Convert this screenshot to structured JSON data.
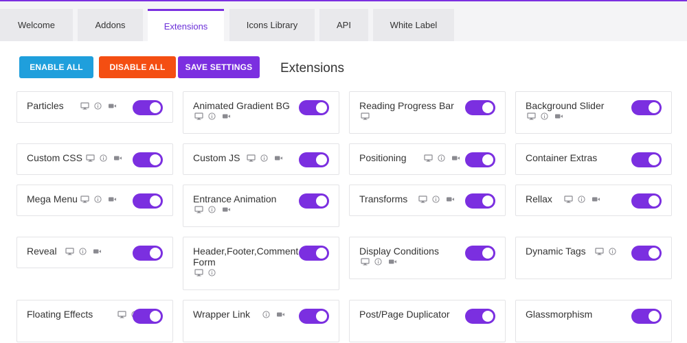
{
  "tabs": [
    "Welcome",
    "Addons",
    "Extensions",
    "Icons Library",
    "API",
    "White Label"
  ],
  "active_tab": "Extensions",
  "buttons": {
    "enable_all": "ENABLE ALL",
    "disable_all": "DISABLE ALL",
    "save_settings": "SAVE SETTINGS"
  },
  "section_title": "Extensions",
  "colors": {
    "accent": "#7b2fe0",
    "enable": "#1f9fdc",
    "disable": "#f44e12"
  },
  "extensions": [
    {
      "name": "Particles",
      "icons": [
        "desktop-icon",
        "info-icon",
        "video-icon"
      ],
      "enabled": true
    },
    {
      "name": "Animated Gradient BG",
      "icons": [
        "desktop-icon",
        "info-icon",
        "video-icon"
      ],
      "enabled": true
    },
    {
      "name": "Reading Progress Bar",
      "icons": [
        "desktop-icon"
      ],
      "enabled": true
    },
    {
      "name": "Background Slider",
      "icons": [
        "desktop-icon",
        "info-icon",
        "video-icon"
      ],
      "enabled": true
    },
    {
      "name": "Custom CSS",
      "icons": [
        "desktop-icon",
        "info-icon",
        "video-icon"
      ],
      "enabled": true
    },
    {
      "name": "Custom JS",
      "icons": [
        "desktop-icon",
        "info-icon",
        "video-icon"
      ],
      "enabled": true
    },
    {
      "name": "Positioning",
      "icons": [
        "desktop-icon",
        "info-icon",
        "video-icon"
      ],
      "enabled": true
    },
    {
      "name": "Container Extras",
      "icons": [],
      "enabled": true
    },
    {
      "name": "Mega Menu",
      "icons": [
        "desktop-icon",
        "info-icon",
        "video-icon"
      ],
      "enabled": true
    },
    {
      "name": "Entrance Animation",
      "icons": [
        "desktop-icon",
        "info-icon",
        "video-icon"
      ],
      "enabled": true
    },
    {
      "name": "Transforms",
      "icons": [
        "desktop-icon",
        "info-icon",
        "video-icon"
      ],
      "enabled": true
    },
    {
      "name": "Rellax",
      "icons": [
        "desktop-icon",
        "info-icon",
        "video-icon"
      ],
      "enabled": true
    },
    {
      "name": "Reveal",
      "icons": [
        "desktop-icon",
        "info-icon",
        "video-icon"
      ],
      "enabled": true
    },
    {
      "name": "Header,Footer,Comment Form",
      "icons": [
        "desktop-icon",
        "info-icon"
      ],
      "enabled": true
    },
    {
      "name": "Display Conditions",
      "icons": [
        "desktop-icon",
        "info-icon",
        "video-icon"
      ],
      "enabled": true
    },
    {
      "name": "Dynamic Tags",
      "icons": [
        "desktop-icon",
        "info-icon"
      ],
      "enabled": true
    },
    {
      "name": "Floating Effects",
      "icons": [
        "desktop-icon",
        "info-icon"
      ],
      "enabled": true
    },
    {
      "name": "Wrapper Link",
      "icons": [
        "info-icon",
        "video-icon"
      ],
      "enabled": true
    },
    {
      "name": "Post/Page Duplicator",
      "icons": [],
      "enabled": true
    },
    {
      "name": "Glassmorphism",
      "icons": [],
      "enabled": true
    }
  ]
}
